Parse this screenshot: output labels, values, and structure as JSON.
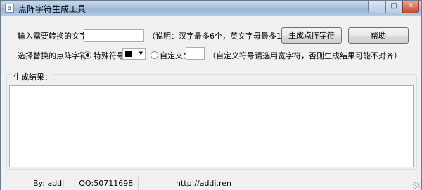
{
  "window": {
    "title": "点阵字符生成工具",
    "app_icon": "d",
    "controls": {
      "minimize": "—",
      "maximize": "□",
      "close": "✕"
    }
  },
  "form": {
    "input_label": "输入需要转换的文字：",
    "input_value": "",
    "note": "（说明：汉字最多6个，英文字母最多12个）",
    "generate_button": "生成点阵字符",
    "help_button": "帮助",
    "replace_label": "选择替换的点阵字符：",
    "special_label": "特殊符号",
    "special_selected_symbol": "■",
    "custom_label": "自定义：",
    "custom_value": "",
    "custom_note": "（自定义符号请选用宽字符，否则生成结果可能不对齐）"
  },
  "result": {
    "label": "生成结果：",
    "value": ""
  },
  "status": {
    "author": "By: addi",
    "qq": "QQ:50711698",
    "url": "http://addi.ren"
  },
  "colors": {
    "titlebar": "#a9c2de",
    "face": "#f0f0f0",
    "close": "#c7452e"
  }
}
